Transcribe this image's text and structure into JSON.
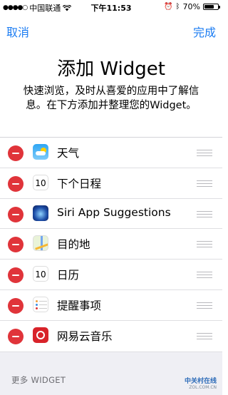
{
  "status_bar": {
    "carrier": "中国联通",
    "time": "下午11:53",
    "battery": "70%",
    "battery_level": 0.7
  },
  "nav": {
    "cancel_label": "取消",
    "done_label": "完成"
  },
  "header": {
    "title": "添加 Widget",
    "subtitle": "快速浏览，及时从喜爱的应用中了解信息。在下方添加并整理您的Widget。"
  },
  "widgets": [
    {
      "label": "天气",
      "icon": "weather-icon"
    },
    {
      "label": "下个日程",
      "icon": "calendar-icon",
      "icon_text": "10"
    },
    {
      "label": "Siri App Suggestions",
      "icon": "siri-icon"
    },
    {
      "label": "目的地",
      "icon": "maps-icon"
    },
    {
      "label": "日历",
      "icon": "calendar-icon",
      "icon_text": "10"
    },
    {
      "label": "提醒事项",
      "icon": "reminders-icon"
    },
    {
      "label": "网易云音乐",
      "icon": "netease-music-icon"
    }
  ],
  "more_section": {
    "label": "更多 WIDGET"
  },
  "watermark": {
    "line1": "中关村在线",
    "line2": "ZOL.COM.CN"
  },
  "colors": {
    "accent": "#1b7cf2",
    "delete": "#e0343a"
  }
}
